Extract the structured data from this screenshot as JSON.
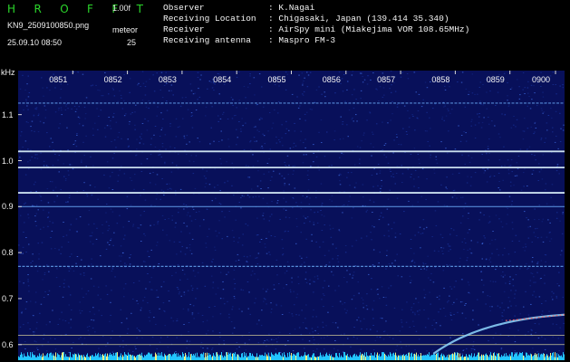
{
  "header": {
    "logo": "H R O F F T",
    "version": "1.00f",
    "filename": "KN9_2509100850.png",
    "datetime": "25.09.10 08:50",
    "meteor_label": "meteor",
    "meteor_count": "25",
    "fields": [
      {
        "label": "Observer",
        "value": ": K.Nagai"
      },
      {
        "label": "Receiving Location",
        "value": ": Chigasaki, Japan (139.414 35.340)"
      },
      {
        "label": "Receiver",
        "value": ": AirSpy mini (Miakejima VOR 108.65MHz)"
      },
      {
        "label": "Receiving antenna",
        "value": ": Maspro FM-3"
      }
    ]
  },
  "chart_data": {
    "type": "heatmap",
    "ylabel": "kHz",
    "y_ticks": [
      "1.1",
      "1.0",
      "0.9",
      "0.8",
      "0.7",
      "0.6"
    ],
    "y_range": [
      0.57,
      1.18
    ],
    "x_ticks": [
      "0851",
      "0852",
      "0853",
      "0854",
      "0855",
      "0856",
      "0857",
      "0858",
      "0859",
      "0900"
    ],
    "x_range_minutes": [
      0,
      10
    ],
    "constant_lines_khz": [
      1.125,
      1.02,
      0.985,
      0.93,
      0.9,
      0.77,
      0.62,
      0.6
    ],
    "meteor_trace": {
      "start": {
        "minute": 7.6,
        "khz": 0.58
      },
      "end": {
        "minute": 10.0,
        "khz": 0.665
      }
    },
    "colors": {
      "background": "#08105a",
      "noise": "#1c3aa8",
      "line": "#6fb3ff",
      "line_bright": "#dff6ff",
      "reference_line": "#f0e6a0",
      "bottom_band": "#22c4ff",
      "trace": "#ff6666"
    }
  }
}
